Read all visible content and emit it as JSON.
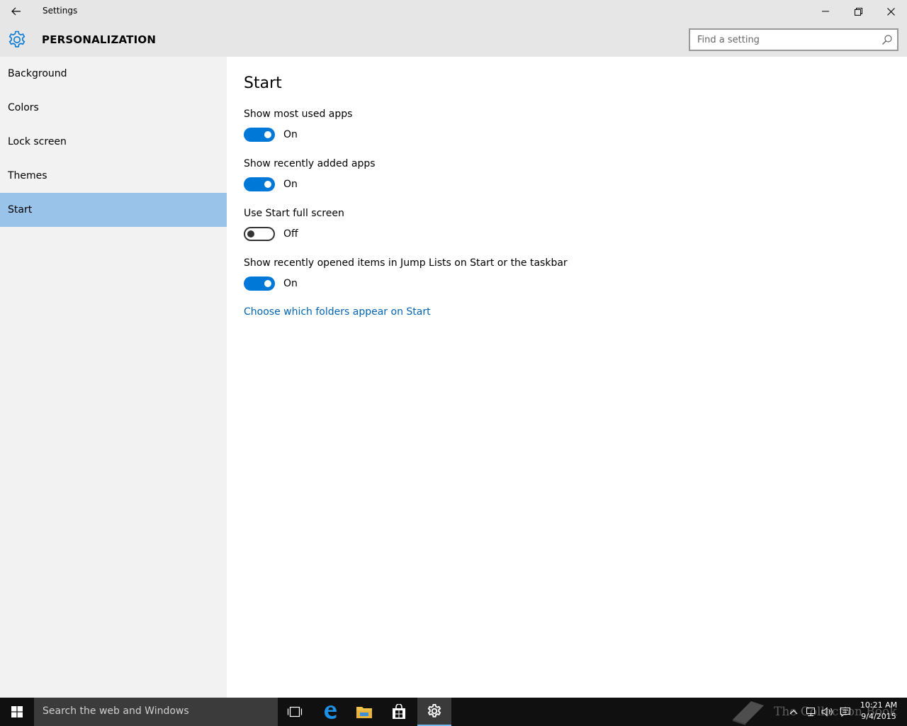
{
  "window": {
    "title": "Settings",
    "back_icon": "back-arrow-icon",
    "controls": [
      "minimize-icon",
      "restore-icon",
      "close-icon"
    ]
  },
  "header": {
    "icon": "gear-icon",
    "section_title": "PERSONALIZATION",
    "search_placeholder": "Find a setting"
  },
  "sidebar": {
    "items": [
      {
        "label": "Background",
        "active": false
      },
      {
        "label": "Colors",
        "active": false
      },
      {
        "label": "Lock screen",
        "active": false
      },
      {
        "label": "Themes",
        "active": false
      },
      {
        "label": "Start",
        "active": true
      }
    ]
  },
  "main": {
    "title": "Start",
    "settings": [
      {
        "label": "Show most used apps",
        "state": "On",
        "on": true
      },
      {
        "label": "Show recently added apps",
        "state": "On",
        "on": true
      },
      {
        "label": "Use Start full screen",
        "state": "Off",
        "on": false
      },
      {
        "label": "Show recently opened items in Jump Lists on Start or the taskbar",
        "state": "On",
        "on": true
      }
    ],
    "link": "Choose which folders appear on Start"
  },
  "taskbar": {
    "search_placeholder": "Search the web and Windows",
    "icons": [
      "windows-start-icon",
      "task-view-icon",
      "edge-browser-icon",
      "file-explorer-icon",
      "store-icon",
      "settings-gear-icon"
    ],
    "tray_icons": [
      "chevron-up-icon",
      "network-icon",
      "volume-icon",
      "action-center-icon"
    ],
    "watermark": "The Collection Book",
    "time": "10:21 AM",
    "date": "9/4/2015"
  },
  "colors": {
    "accent": "#0078d7",
    "sidebar_selected": "#99c3e9",
    "link": "#0063b1",
    "titlebar": "#e6e6e6",
    "sidebar": "#f2f2f2",
    "taskbar": "#101010"
  }
}
